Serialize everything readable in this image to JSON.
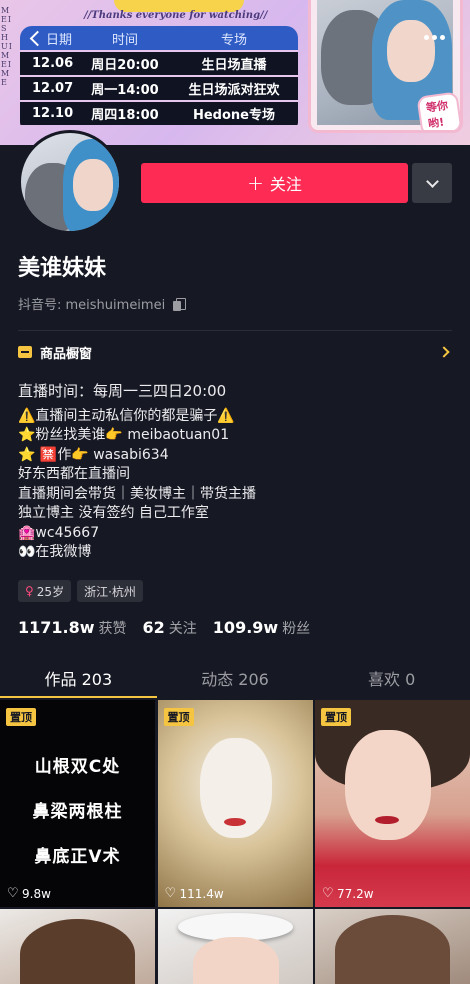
{
  "banner": {
    "side_text": "MEISHUIMEIME",
    "thanks": "//Thanks everyone for watching//",
    "schedule_header": [
      "日期",
      "时间",
      "专场"
    ],
    "schedule_rows": [
      [
        "12.06",
        "周日20:00",
        "生日场直播"
      ],
      [
        "12.07",
        "周一14:00",
        "生日场派对狂欢"
      ],
      [
        "12.10",
        "周四18:00",
        "Hedone专场"
      ]
    ],
    "sticker": "等你哟!"
  },
  "profile": {
    "follow_label": "关注",
    "follow_plus": "+",
    "nickname": "美谁妹妹",
    "douyin_id_label": "抖音号: meishuimeimei",
    "shop_label": "商品橱窗",
    "bio": [
      "直播时间：每周一三四日20:00",
      "⚠️直播间主动私信你的都是骗子⚠️",
      "⭐粉丝找美谁👉 meibaotuan01",
      "⭐ 🈲作👉 wasabi634",
      "好东西都在直播间",
      "直播期间会带货｜美妆博主｜带货主播",
      "独立博主 没有签约 自己工作室",
      "🏩wc45667",
      "👀在我微博"
    ],
    "tags": {
      "age": "25岁",
      "location": "浙江·杭州",
      "gender_icon": "♀"
    },
    "stats": {
      "likes_num": "1171.8w",
      "likes_label": "获赞",
      "following_num": "62",
      "following_label": "关注",
      "followers_num": "109.9w",
      "followers_label": "粉丝"
    }
  },
  "tabs": {
    "works": "作品 203",
    "dynamics": "动态 206",
    "likes": "喜欢 0"
  },
  "grid": {
    "pin_label": "置顶",
    "post1_lines": [
      "山根双C处",
      "鼻梁两根柱",
      "鼻底正V术"
    ],
    "post1_likes": "9.8w",
    "post2_likes": "111.4w",
    "post3_likes": "77.2w"
  },
  "colors": {
    "accent": "#fe2c55",
    "highlight": "#f5c542",
    "background": "#161823"
  }
}
